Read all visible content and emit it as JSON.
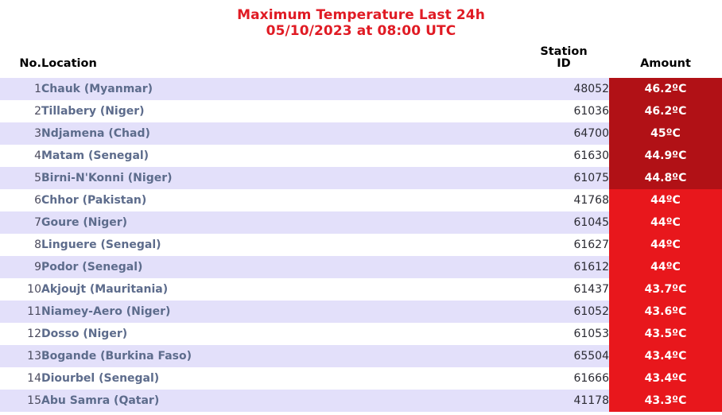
{
  "title": {
    "line1": "Maximum Temperature Last 24h",
    "line2": "05/10/2023 at 08:00 UTC",
    "color": "#e01b24"
  },
  "colors": {
    "stripe": "#e3e0fa",
    "row_background": "#ffffff",
    "location_text": "#5d6c8c",
    "amount_hot_dark": "#b11116",
    "amount_hot_light": "#e8171c",
    "amount_text": "#ffffff",
    "header_text": "#000000"
  },
  "table": {
    "headers": {
      "no": "No.",
      "location": "Location",
      "station_id_line1": "Station",
      "station_id_line2": "ID",
      "amount": "Amount"
    },
    "rows": [
      {
        "no": "1",
        "location": "Chauk (Myanmar)",
        "station_id": "48052",
        "amount": "46.2ºC",
        "heat": "dark"
      },
      {
        "no": "2",
        "location": "Tillabery (Niger)",
        "station_id": "61036",
        "amount": "46.2ºC",
        "heat": "dark"
      },
      {
        "no": "3",
        "location": "Ndjamena (Chad)",
        "station_id": "64700",
        "amount": "45ºC",
        "heat": "dark"
      },
      {
        "no": "4",
        "location": "Matam (Senegal)",
        "station_id": "61630",
        "amount": "44.9ºC",
        "heat": "dark"
      },
      {
        "no": "5",
        "location": "Birni-N'Konni (Niger)",
        "station_id": "61075",
        "amount": "44.8ºC",
        "heat": "dark"
      },
      {
        "no": "6",
        "location": "Chhor (Pakistan)",
        "station_id": "41768",
        "amount": "44ºC",
        "heat": "light"
      },
      {
        "no": "7",
        "location": "Goure (Niger)",
        "station_id": "61045",
        "amount": "44ºC",
        "heat": "light"
      },
      {
        "no": "8",
        "location": "Linguere (Senegal)",
        "station_id": "61627",
        "amount": "44ºC",
        "heat": "light"
      },
      {
        "no": "9",
        "location": "Podor (Senegal)",
        "station_id": "61612",
        "amount": "44ºC",
        "heat": "light"
      },
      {
        "no": "10",
        "location": "Akjoujt (Mauritania)",
        "station_id": "61437",
        "amount": "43.7ºC",
        "heat": "light"
      },
      {
        "no": "11",
        "location": "Niamey-Aero (Niger)",
        "station_id": "61052",
        "amount": "43.6ºC",
        "heat": "light"
      },
      {
        "no": "12",
        "location": "Dosso (Niger)",
        "station_id": "61053",
        "amount": "43.5ºC",
        "heat": "light"
      },
      {
        "no": "13",
        "location": "Bogande (Burkina Faso)",
        "station_id": "65504",
        "amount": "43.4ºC",
        "heat": "light"
      },
      {
        "no": "14",
        "location": "Diourbel (Senegal)",
        "station_id": "61666",
        "amount": "43.4ºC",
        "heat": "light"
      },
      {
        "no": "15",
        "location": "Abu Samra (Qatar)",
        "station_id": "41178",
        "amount": "43.3ºC",
        "heat": "light"
      }
    ]
  }
}
